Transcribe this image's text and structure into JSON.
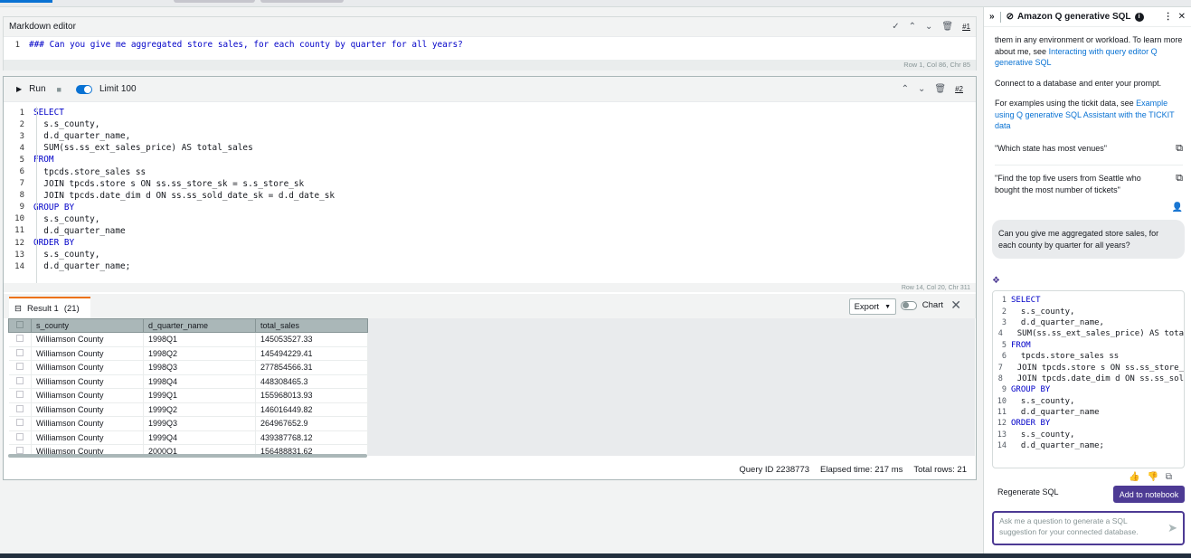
{
  "cell1": {
    "title": "Markdown editor",
    "cell_number": "#1",
    "line_number": "1",
    "text": "### Can you give me aggregated store sales, for each county by quarter for all years?",
    "status": "Row 1,  Col 86,  Chr 85"
  },
  "cell2": {
    "run_label": "Run",
    "limit_label": "Limit 100",
    "cell_number": "#2",
    "status": "Row 14,  Col 20,  Chr 311",
    "code": [
      {
        "n": "1",
        "indent": "",
        "kw": "SELECT",
        "text": ""
      },
      {
        "n": "2",
        "indent": "  ",
        "kw": "",
        "text": "s.s_county,"
      },
      {
        "n": "3",
        "indent": "  ",
        "kw": "",
        "text": "d.d_quarter_name,"
      },
      {
        "n": "4",
        "indent": "  ",
        "kw": "",
        "text": "SUM(ss.ss_ext_sales_price) AS total_sales"
      },
      {
        "n": "5",
        "indent": "",
        "kw": "FROM",
        "text": ""
      },
      {
        "n": "6",
        "indent": "  ",
        "kw": "",
        "text": "tpcds.store_sales ss"
      },
      {
        "n": "7",
        "indent": "  ",
        "kw": "",
        "text": "JOIN tpcds.store s ON ss.ss_store_sk = s.s_store_sk"
      },
      {
        "n": "8",
        "indent": "  ",
        "kw": "",
        "text": "JOIN tpcds.date_dim d ON ss.ss_sold_date_sk = d.d_date_sk"
      },
      {
        "n": "9",
        "indent": "",
        "kw": "GROUP BY",
        "text": ""
      },
      {
        "n": "10",
        "indent": "  ",
        "kw": "",
        "text": "s.s_county,"
      },
      {
        "n": "11",
        "indent": "  ",
        "kw": "",
        "text": "d.d_quarter_name"
      },
      {
        "n": "12",
        "indent": "",
        "kw": "ORDER BY",
        "text": ""
      },
      {
        "n": "13",
        "indent": "  ",
        "kw": "",
        "text": "s.s_county,"
      },
      {
        "n": "14",
        "indent": "  ",
        "kw": "",
        "text": "d.d_quarter_name;"
      }
    ]
  },
  "result": {
    "tab_label": "Result 1",
    "count": "(21)",
    "export_label": "Export",
    "chart_label": "Chart",
    "columns": [
      "s_county",
      "d_quarter_name",
      "total_sales"
    ],
    "rows": [
      [
        "Williamson County",
        "1998Q1",
        "145053527.33"
      ],
      [
        "Williamson County",
        "1998Q2",
        "145494229.41"
      ],
      [
        "Williamson County",
        "1998Q3",
        "277854566.31"
      ],
      [
        "Williamson County",
        "1998Q4",
        "448308465.3"
      ],
      [
        "Williamson County",
        "1999Q1",
        "155968013.93"
      ],
      [
        "Williamson County",
        "1999Q2",
        "146016449.82"
      ],
      [
        "Williamson County",
        "1999Q3",
        "264967652.9"
      ],
      [
        "Williamson County",
        "1999Q4",
        "439387768.12"
      ],
      [
        "Williamson County",
        "2000Q1",
        "156488831.62"
      ]
    ],
    "query_id": "Query ID 2238773",
    "elapsed": "Elapsed time: 217 ms",
    "total_rows": "Total rows: 21"
  },
  "panel": {
    "title": "Amazon Q generative SQL",
    "intro_text": "them in any environment or workload. To learn more about me, see",
    "intro_link": "Interacting with query editor Q generative SQL",
    "connect_text": "Connect to a database and enter your prompt.",
    "examples_text": "For examples using the tickit data, see",
    "examples_link": "Example using Q generative SQL Assistant with the TICKIT data",
    "suggestion1": "\"Which state has most venues\"",
    "suggestion2": "\"Find the top five users from Seattle who bought the most number of tickets\"",
    "user_prompt": "Can you give me aggregated store sales, for each county by quarter for all years?",
    "code": [
      {
        "n": "1",
        "kw": "SELECT",
        "text": ""
      },
      {
        "n": "2",
        "kw": "",
        "text": "  s.s_county,"
      },
      {
        "n": "3",
        "kw": "",
        "text": "  d.d_quarter_name,"
      },
      {
        "n": "4",
        "kw": "",
        "text": "  SUM(ss.ss_ext_sales_price) AS tota"
      },
      {
        "n": "5",
        "kw": "FROM",
        "text": ""
      },
      {
        "n": "6",
        "kw": "",
        "text": "  tpcds.store_sales ss"
      },
      {
        "n": "7",
        "kw": "",
        "text": "  JOIN tpcds.store s ON ss.ss_store_"
      },
      {
        "n": "8",
        "kw": "",
        "text": "  JOIN tpcds.date_dim d ON ss.ss_sol"
      },
      {
        "n": "9",
        "kw": "GROUP BY",
        "text": ""
      },
      {
        "n": "10",
        "kw": "",
        "text": "  s.s_county,"
      },
      {
        "n": "11",
        "kw": "",
        "text": "  d.d_quarter_name"
      },
      {
        "n": "12",
        "kw": "ORDER BY",
        "text": ""
      },
      {
        "n": "13",
        "kw": "",
        "text": "  s.s_county,"
      },
      {
        "n": "14",
        "kw": "",
        "text": "  d.d_quarter_name;"
      }
    ],
    "regenerate_label": "Regenerate SQL",
    "add_label": "Add to notebook",
    "ask_placeholder": "Ask me a question to generate a SQL suggestion for your connected database."
  },
  "colors": {
    "accent": "#0972d3",
    "q_purple": "#4d3a94",
    "result_tab": "#ec7211",
    "keyword": "#0000c8"
  },
  "icons": [
    "check-icon",
    "chevron-up-icon",
    "chevron-down-icon",
    "trash-icon",
    "play-icon",
    "stop-icon",
    "table-icon",
    "close-icon",
    "collapse-icon",
    "q-logo-icon",
    "info-icon",
    "more-icon",
    "copy-icon",
    "user-icon",
    "q-chat-icon",
    "thumbs-up-icon",
    "thumbs-down-icon",
    "send-icon"
  ]
}
